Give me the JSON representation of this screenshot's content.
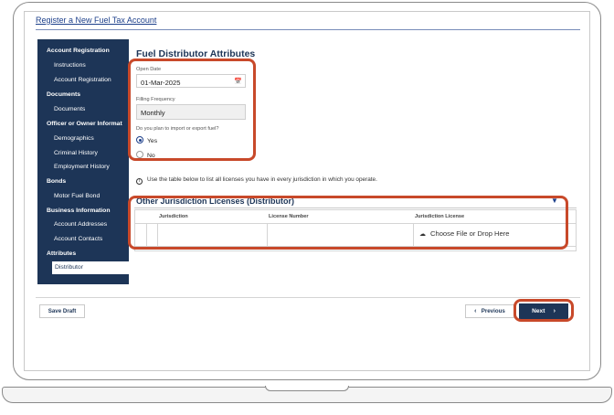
{
  "page": {
    "header_link": "Register a New Fuel Tax Account"
  },
  "sidebar": {
    "items": [
      {
        "label": "Account Registration",
        "type": "section"
      },
      {
        "label": "Instructions",
        "type": "sub"
      },
      {
        "label": "Account Registration",
        "type": "sub"
      },
      {
        "label": "Documents",
        "type": "section"
      },
      {
        "label": "Documents",
        "type": "sub"
      },
      {
        "label": "Officer or Owner Informat",
        "type": "section"
      },
      {
        "label": "Demographics",
        "type": "sub"
      },
      {
        "label": "Criminal History",
        "type": "sub"
      },
      {
        "label": "Employment History",
        "type": "sub"
      },
      {
        "label": "Bonds",
        "type": "section"
      },
      {
        "label": "Motor Fuel Bond",
        "type": "sub"
      },
      {
        "label": "Business Information",
        "type": "section"
      },
      {
        "label": "Account Addresses",
        "type": "sub"
      },
      {
        "label": "Account Contacts",
        "type": "sub"
      },
      {
        "label": "Attributes",
        "type": "section"
      },
      {
        "label": "Distributor",
        "type": "active"
      }
    ]
  },
  "form": {
    "title": "Fuel Distributor Attributes",
    "open_date_label": "Open Date",
    "open_date_value": "01-Mar-2025",
    "filing_frequency_label": "Filling Frequency",
    "filing_frequency_value": "Monthly",
    "import_export_question": "Do you plan to import or export fuel?",
    "options": [
      {
        "label": "Yes",
        "selected": true
      },
      {
        "label": "No",
        "selected": false
      }
    ]
  },
  "info_text": "Use the table below to list all licenses you have in every jurisdiction in which you operate.",
  "licenses_table": {
    "title": "Other Jurisdiction Licenses (Distributor)",
    "columns": [
      "Jurisdiction",
      "License Number",
      "Jurisdiction License"
    ],
    "upload_label": "Choose File or Drop Here"
  },
  "footer": {
    "save_draft": "Save Draft",
    "previous": "Previous",
    "next": "Next"
  },
  "colors": {
    "sidebar_bg": "#1d3557",
    "accent": "#1c3f8a",
    "highlight": "#c8492a"
  },
  "icons": [
    "calendar-icon",
    "info-icon",
    "filter-icon",
    "cloud-upload-icon",
    "chevron-left-icon",
    "chevron-right-icon"
  ]
}
